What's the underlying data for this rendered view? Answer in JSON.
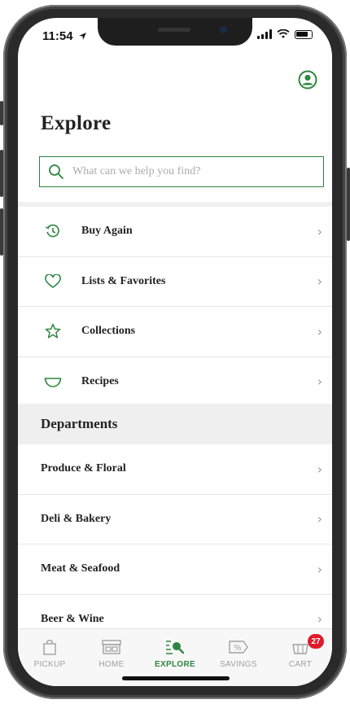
{
  "status_bar": {
    "time": "11:54"
  },
  "header": {
    "title": "Explore"
  },
  "search": {
    "placeholder": "What can we help you find?"
  },
  "quick_links": [
    {
      "label": "Buy Again",
      "icon": "reorder-clock-icon"
    },
    {
      "label": "Lists & Favorites",
      "icon": "heart-icon"
    },
    {
      "label": "Collections",
      "icon": "star-icon"
    },
    {
      "label": "Recipes",
      "icon": "bowl-icon"
    }
  ],
  "departments": {
    "heading": "Departments",
    "items": [
      {
        "label": "Produce & Floral"
      },
      {
        "label": "Deli & Bakery"
      },
      {
        "label": "Meat & Seafood"
      },
      {
        "label": "Beer & Wine"
      }
    ]
  },
  "tabbar": {
    "tabs": [
      {
        "label": "PICKUP",
        "icon": "bag-icon",
        "active": false
      },
      {
        "label": "HOME",
        "icon": "storefront-icon",
        "active": false
      },
      {
        "label": "EXPLORE",
        "icon": "explore-search-icon",
        "active": true
      },
      {
        "label": "SAVINGS",
        "icon": "coupon-icon",
        "active": false
      },
      {
        "label": "CART",
        "icon": "cart-icon",
        "active": false
      }
    ],
    "cart_count": "27"
  },
  "colors": {
    "accent": "#2e8540",
    "badge": "#e01a2b"
  }
}
